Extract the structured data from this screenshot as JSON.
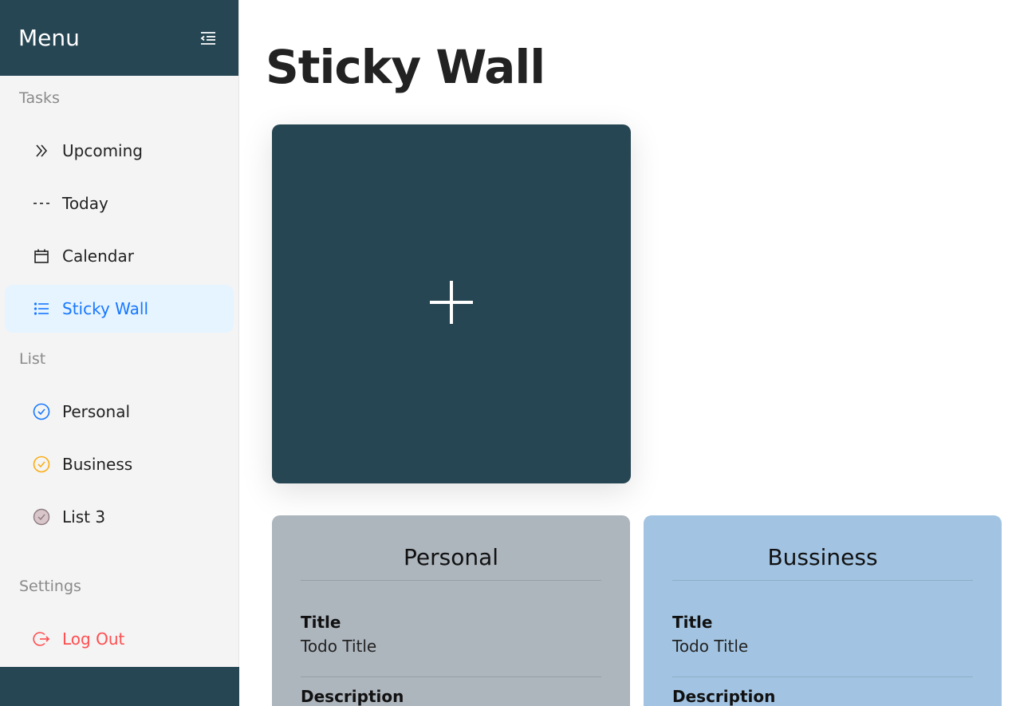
{
  "sidebar": {
    "title": "Menu",
    "sections": {
      "tasks": "Tasks",
      "list": "List",
      "settings": "Settings"
    },
    "tasks": [
      {
        "label": "Upcoming",
        "icon": "double-chevron-right-icon"
      },
      {
        "label": "Today",
        "icon": "dashes-icon"
      },
      {
        "label": "Calendar",
        "icon": "calendar-icon"
      },
      {
        "label": "Sticky Wall",
        "icon": "list-icon",
        "active": true
      }
    ],
    "lists": [
      {
        "label": "Personal",
        "icon": "check-circle-icon",
        "color": "#1677ff"
      },
      {
        "label": "Business",
        "icon": "check-circle-icon",
        "color": "#faad14"
      },
      {
        "label": "List 3",
        "icon": "check-circle-icon",
        "color": "#b9a3a8"
      }
    ],
    "logout": {
      "label": "Log Out",
      "icon": "logout-icon",
      "color": "#ff4d4f"
    }
  },
  "main": {
    "title": "Sticky Wall",
    "add_icon": "plus-icon",
    "notes": [
      {
        "heading": "Personal",
        "title_label": "Title",
        "title_value": "Todo Title",
        "description_label": "Description",
        "color": "#adb5bd"
      },
      {
        "heading": "Bussiness",
        "title_label": "Title",
        "title_value": "Todo Title",
        "description_label": "Description",
        "color": "#a2c4e2"
      }
    ]
  },
  "colors": {
    "primary_dark": "#264653",
    "accent": "#1677ff",
    "danger": "#ff4d4f"
  }
}
